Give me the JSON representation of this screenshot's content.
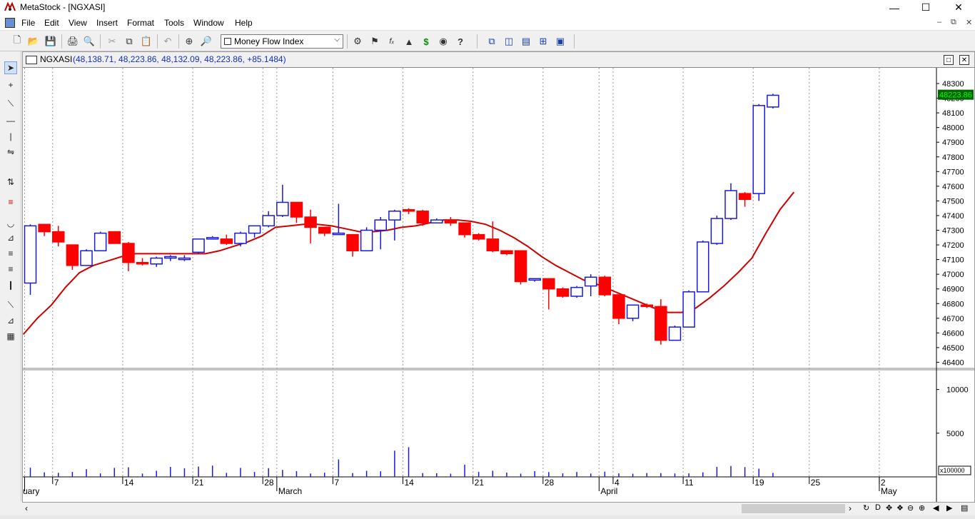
{
  "window": {
    "title": "MetaStock - [NGXASI]"
  },
  "menu": [
    "File",
    "Edit",
    "View",
    "Insert",
    "Format",
    "Tools",
    "Window",
    "Help"
  ],
  "toolbar": {
    "indicator": "Money Flow Index"
  },
  "chart": {
    "symbol": "NGXASI",
    "values": "(48,138.71, 48,223.86, 48,132.09, 48,223.86, +85.1484)",
    "last_price_label": "48223.86",
    "volume_unit": "x100000"
  },
  "colors": {
    "up": "#1a1adc",
    "down": "#ff0000",
    "ma": "#d00000",
    "price_tag_bg": "#006400",
    "price_tag_fg": "#00ff00"
  },
  "chart_data": {
    "type": "candlestick",
    "price_axis": {
      "min": 46400,
      "max": 48300,
      "step": 100
    },
    "volume_axis": {
      "ticks": [
        5000,
        10000
      ]
    },
    "date_labels": [
      {
        "i": 0,
        "text": "uary"
      },
      {
        "i": 2,
        "text": "7"
      },
      {
        "i": 7,
        "text": "14"
      },
      {
        "i": 12,
        "text": "21"
      },
      {
        "i": 17,
        "text": "28"
      },
      {
        "i": 18,
        "text": "March"
      },
      {
        "i": 22,
        "text": "7"
      },
      {
        "i": 27,
        "text": "14"
      },
      {
        "i": 32,
        "text": "21"
      },
      {
        "i": 37,
        "text": "28"
      },
      {
        "i": 41,
        "text": "April"
      },
      {
        "i": 42,
        "text": "4"
      },
      {
        "i": 47,
        "text": "11"
      },
      {
        "i": 52,
        "text": "19"
      },
      {
        "i": 56,
        "text": "25"
      },
      {
        "i": 61,
        "text": "2"
      },
      {
        "i": 61,
        "text": "May"
      }
    ],
    "candles": [
      {
        "o": 46940,
        "h": 47340,
        "l": 46860,
        "c": 47330,
        "v": 1050
      },
      {
        "o": 47340,
        "h": 47340,
        "l": 47260,
        "c": 47290,
        "v": 520
      },
      {
        "o": 47290,
        "h": 47330,
        "l": 47190,
        "c": 47220,
        "v": 460
      },
      {
        "o": 47200,
        "h": 47200,
        "l": 47030,
        "c": 47060,
        "v": 560
      },
      {
        "o": 47060,
        "h": 47170,
        "l": 47060,
        "c": 47160,
        "v": 880
      },
      {
        "o": 47160,
        "h": 47290,
        "l": 47160,
        "c": 47280,
        "v": 400
      },
      {
        "o": 47290,
        "h": 47290,
        "l": 47230,
        "c": 47210,
        "v": 1030
      },
      {
        "o": 47210,
        "h": 47220,
        "l": 47020,
        "c": 47080,
        "v": 1100
      },
      {
        "o": 47080,
        "h": 47110,
        "l": 47060,
        "c": 47070,
        "v": 380
      },
      {
        "o": 47070,
        "h": 47120,
        "l": 47050,
        "c": 47110,
        "v": 700
      },
      {
        "o": 47110,
        "h": 47130,
        "l": 47090,
        "c": 47120,
        "v": 1140
      },
      {
        "o": 47100,
        "h": 47130,
        "l": 47090,
        "c": 47110,
        "v": 990
      },
      {
        "o": 47150,
        "h": 47240,
        "l": 47140,
        "c": 47240,
        "v": 1180
      },
      {
        "o": 47240,
        "h": 47260,
        "l": 47240,
        "c": 47250,
        "v": 1290
      },
      {
        "o": 47240,
        "h": 47270,
        "l": 47200,
        "c": 47210,
        "v": 460
      },
      {
        "o": 47210,
        "h": 47290,
        "l": 47190,
        "c": 47280,
        "v": 1030
      },
      {
        "o": 47280,
        "h": 47330,
        "l": 47250,
        "c": 47330,
        "v": 560
      },
      {
        "o": 47330,
        "h": 47430,
        "l": 47320,
        "c": 47400,
        "v": 1000
      },
      {
        "o": 47400,
        "h": 47610,
        "l": 47390,
        "c": 47490,
        "v": 800
      },
      {
        "o": 47490,
        "h": 47490,
        "l": 47350,
        "c": 47390,
        "v": 650
      },
      {
        "o": 47390,
        "h": 47440,
        "l": 47210,
        "c": 47320,
        "v": 380
      },
      {
        "o": 47320,
        "h": 47320,
        "l": 47260,
        "c": 47280,
        "v": 480
      },
      {
        "o": 47280,
        "h": 47480,
        "l": 47270,
        "c": 47280,
        "v": 2000
      },
      {
        "o": 47270,
        "h": 47270,
        "l": 47120,
        "c": 47160,
        "v": 440
      },
      {
        "o": 47160,
        "h": 47320,
        "l": 47160,
        "c": 47300,
        "v": 700
      },
      {
        "o": 47300,
        "h": 47390,
        "l": 47170,
        "c": 47370,
        "v": 640
      },
      {
        "o": 47370,
        "h": 47440,
        "l": 47230,
        "c": 47430,
        "v": 3000
      },
      {
        "o": 47440,
        "h": 47450,
        "l": 47410,
        "c": 47430,
        "v": 3400
      },
      {
        "o": 47430,
        "h": 47440,
        "l": 47330,
        "c": 47350,
        "v": 430
      },
      {
        "o": 47350,
        "h": 47380,
        "l": 47350,
        "c": 47370,
        "v": 410
      },
      {
        "o": 47370,
        "h": 47390,
        "l": 47330,
        "c": 47350,
        "v": 370
      },
      {
        "o": 47350,
        "h": 47350,
        "l": 47250,
        "c": 47270,
        "v": 1400
      },
      {
        "o": 47270,
        "h": 47280,
        "l": 47230,
        "c": 47240,
        "v": 560
      },
      {
        "o": 47240,
        "h": 47360,
        "l": 47150,
        "c": 47160,
        "v": 700
      },
      {
        "o": 47160,
        "h": 47160,
        "l": 47130,
        "c": 47140,
        "v": 490
      },
      {
        "o": 47160,
        "h": 47160,
        "l": 46930,
        "c": 46950,
        "v": 370
      },
      {
        "o": 46960,
        "h": 46970,
        "l": 46950,
        "c": 46970,
        "v": 650
      },
      {
        "o": 46970,
        "h": 46970,
        "l": 46760,
        "c": 46900,
        "v": 550
      },
      {
        "o": 46900,
        "h": 46910,
        "l": 46840,
        "c": 46850,
        "v": 400
      },
      {
        "o": 46850,
        "h": 46920,
        "l": 46840,
        "c": 46910,
        "v": 560
      },
      {
        "o": 46920,
        "h": 47000,
        "l": 46850,
        "c": 46980,
        "v": 380
      },
      {
        "o": 46980,
        "h": 46990,
        "l": 46850,
        "c": 46860,
        "v": 600
      },
      {
        "o": 46860,
        "h": 46860,
        "l": 46660,
        "c": 46700,
        "v": 400
      },
      {
        "o": 46700,
        "h": 46790,
        "l": 46680,
        "c": 46790,
        "v": 360
      },
      {
        "o": 46790,
        "h": 46800,
        "l": 46770,
        "c": 46780,
        "v": 440
      },
      {
        "o": 46780,
        "h": 46830,
        "l": 46520,
        "c": 46550,
        "v": 430
      },
      {
        "o": 46550,
        "h": 46650,
        "l": 46550,
        "c": 46640,
        "v": 390
      },
      {
        "o": 46640,
        "h": 46890,
        "l": 46640,
        "c": 46880,
        "v": 400
      },
      {
        "o": 46880,
        "h": 47230,
        "l": 46880,
        "c": 47220,
        "v": 520
      },
      {
        "o": 47210,
        "h": 47400,
        "l": 47200,
        "c": 47380,
        "v": 1150
      },
      {
        "o": 47380,
        "h": 47620,
        "l": 47370,
        "c": 47570,
        "v": 1250
      },
      {
        "o": 47550,
        "h": 47560,
        "l": 47460,
        "c": 47510,
        "v": 1120
      },
      {
        "o": 47550,
        "h": 48160,
        "l": 47500,
        "c": 48150,
        "v": 940
      },
      {
        "o": 48140,
        "h": 48230,
        "l": 48130,
        "c": 48220,
        "v": 450
      }
    ],
    "ma": [
      46590,
      46700,
      46790,
      46910,
      47010,
      47060,
      47090,
      47120,
      47140,
      47140,
      47140,
      47140,
      47140,
      47140,
      47160,
      47190,
      47220,
      47260,
      47320,
      47330,
      47340,
      47340,
      47330,
      47310,
      47290,
      47290,
      47300,
      47320,
      47330,
      47350,
      47370,
      47370,
      47360,
      47340,
      47300,
      47250,
      47190,
      47120,
      47060,
      47010,
      46960,
      46930,
      46890,
      46850,
      46810,
      46770,
      46740,
      46740,
      46770,
      46840,
      46920,
      47010,
      47110,
      47280,
      47440,
      47560
    ]
  }
}
